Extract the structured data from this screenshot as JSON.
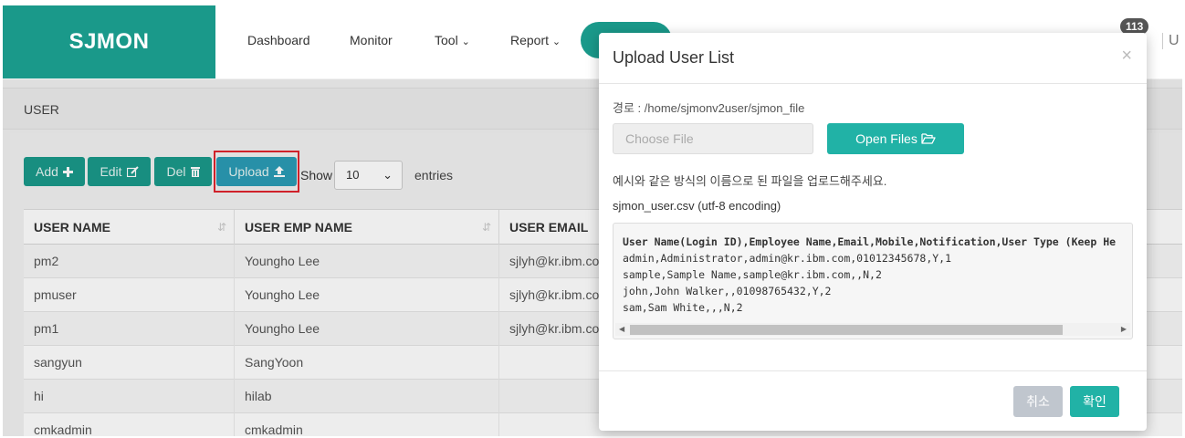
{
  "brand": "SJMON",
  "nav": {
    "items": [
      "Dashboard",
      "Monitor",
      "Tool",
      "Report"
    ],
    "caret": "⌄",
    "badge": "113",
    "user_initial": "U"
  },
  "breadcrumb": "USER",
  "toolbar": {
    "add_label": "Add",
    "add_icon": "plus-icon",
    "edit_label": "Edit",
    "edit_icon": "edit-icon",
    "del_label": "Del",
    "del_icon": "trash-icon",
    "upload_label": "Upload",
    "upload_icon": "upload-icon",
    "show_label": "Show",
    "show_value": "10",
    "entries_label": "entries"
  },
  "table": {
    "columns": [
      "USER NAME",
      "USER EMP NAME",
      "USER EMAIL"
    ],
    "rows": [
      [
        "pm2",
        "Youngho Lee",
        "sjlyh@kr.ibm.com"
      ],
      [
        "pmuser",
        "Youngho Lee",
        "sjlyh@kr.ibm.com"
      ],
      [
        "pm1",
        "Youngho Lee",
        "sjlyh@kr.ibm.com"
      ],
      [
        "sangyun",
        "SangYoon",
        ""
      ],
      [
        "hi",
        "hilab",
        ""
      ],
      [
        "cmkadmin",
        "cmkadmin",
        ""
      ]
    ]
  },
  "modal": {
    "title": "Upload User List",
    "close": "×",
    "path": "경로 : /home/sjmonv2user/sjmon_file",
    "file_placeholder": "Choose File",
    "open_files_label": "Open Files",
    "notice": "예시와 같은 방식의 이름으로 된 파일을 업로드해주세요.",
    "csv_title": "sjmon_user.csv (utf-8 encoding)",
    "csv_lines": [
      "User Name(Login ID),Employee Name,Email,Mobile,Notification,User Type (Keep He",
      "admin,Administrator,admin@kr.ibm.com,01012345678,Y,1",
      "sample,Sample Name,sample@kr.ibm.com,,N,2",
      "john,John Walker,,01098765432,Y,2",
      "sam,Sam White,,,N,2"
    ],
    "cancel_label": "취소",
    "ok_label": "확인"
  },
  "colors": {
    "brand": "#1a998a",
    "primary": "#21b2a6",
    "upload": "#2a9bb5",
    "highlight": "#e0242e",
    "cancel": "#c0c6ce"
  }
}
